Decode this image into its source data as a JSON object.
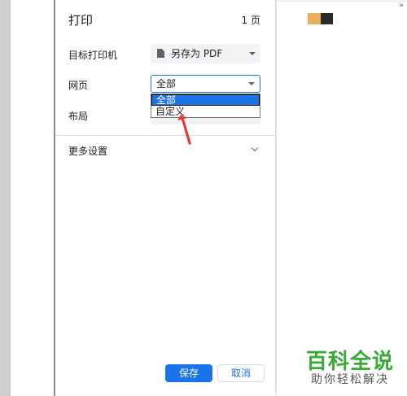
{
  "dialog": {
    "title": "打印",
    "page_count": "1 页"
  },
  "destination": {
    "label": "目标打印机",
    "value": "另存为 PDF",
    "icon": "document-icon"
  },
  "pages": {
    "label": "网页",
    "value": "全部",
    "options": [
      "全部",
      "自定义"
    ],
    "selected_index": 0
  },
  "layout": {
    "label": "布局"
  },
  "more_settings": {
    "label": "更多设置",
    "icon": "chevron-down-icon"
  },
  "buttons": {
    "save": "保存",
    "cancel": "取消"
  },
  "topbar": {
    "overflow": "»"
  },
  "watermark": {
    "title": "百科全说",
    "subtitle": "助你轻松解决"
  },
  "colors": {
    "accent": "#1a73e8",
    "annotation": "#e53935",
    "watermark_green": "#3aaa35"
  }
}
